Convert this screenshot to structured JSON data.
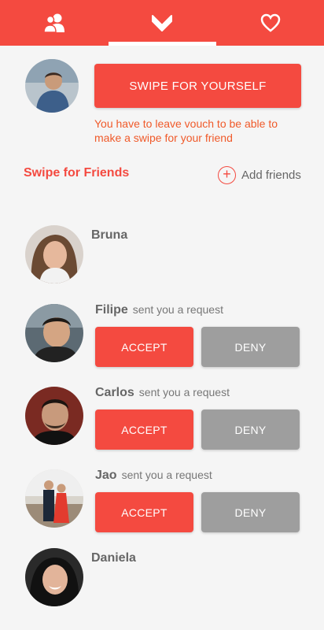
{
  "nav": {
    "tabs": [
      {
        "icon": "friends-icon"
      },
      {
        "icon": "swipe-chevron-icon",
        "active": true
      },
      {
        "icon": "heart-icon"
      }
    ]
  },
  "self": {
    "swipe_button": "SWIPE FOR YOURSELF",
    "note": "You have to leave vouch to be able to make a swipe for your friend"
  },
  "friends_section": {
    "title": "Swipe for Friends",
    "add_label": "Add friends",
    "add_symbol": "+"
  },
  "friends": [
    {
      "name": "Bruna"
    },
    {
      "name": "Filipe",
      "request_text": "sent you a request",
      "accept": "ACCEPT",
      "deny": "DENY"
    },
    {
      "name": "Carlos",
      "request_text": "sent you a request",
      "accept": "ACCEPT",
      "deny": "DENY"
    },
    {
      "name": "Jao",
      "request_text": "sent you a request",
      "accept": "ACCEPT",
      "deny": "DENY"
    },
    {
      "name": "Daniela"
    }
  ],
  "colors": {
    "accent": "#f44a40",
    "deny": "#9e9e9e",
    "note": "#f05a2a"
  }
}
